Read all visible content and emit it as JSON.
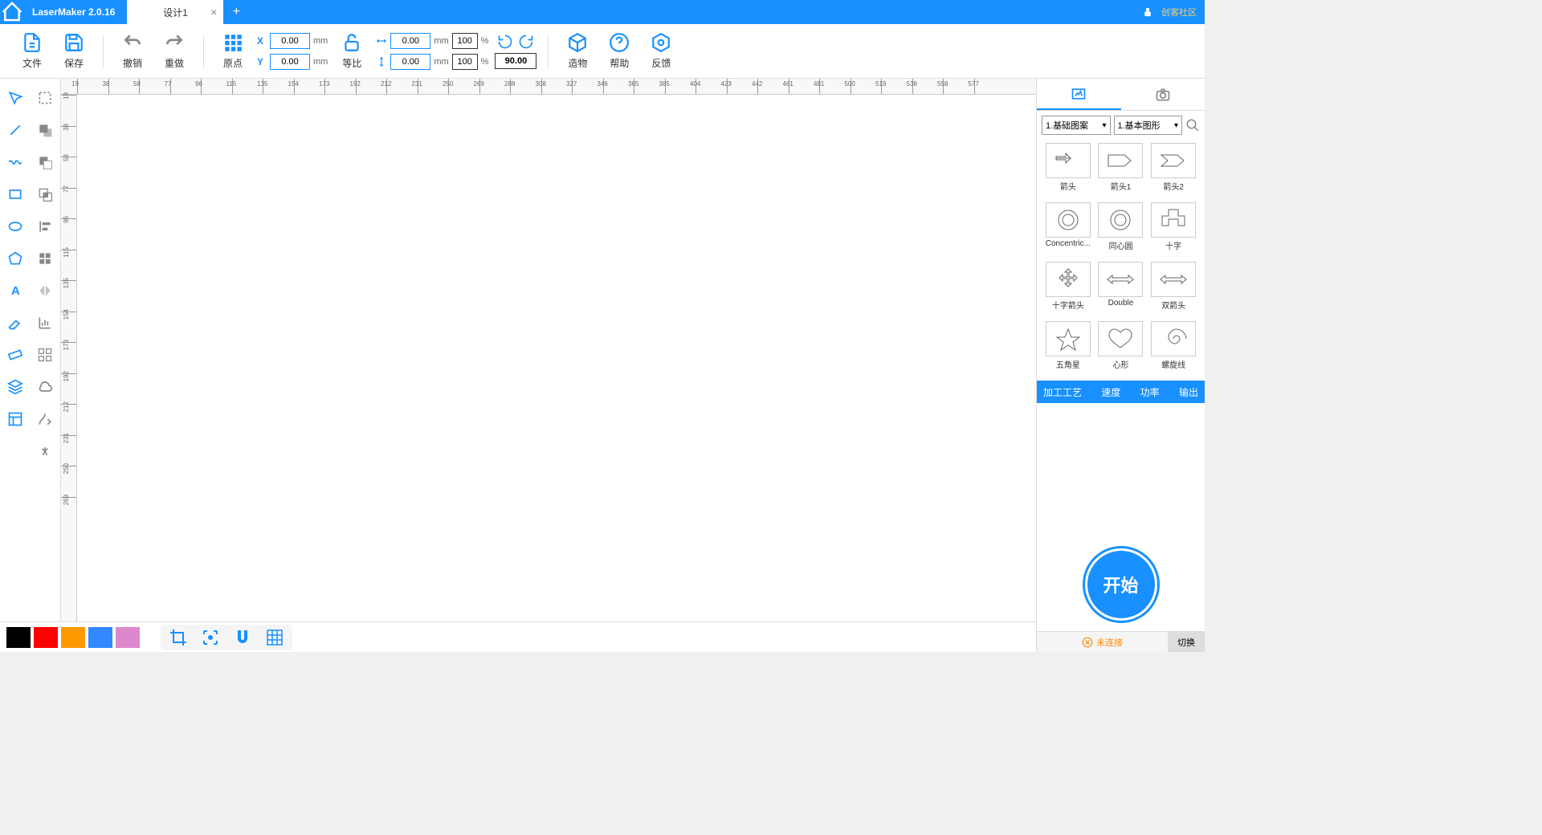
{
  "app": {
    "name": "LaserMaker 2.0.16",
    "community": "创客社区"
  },
  "tabs": [
    {
      "label": "设计1"
    }
  ],
  "toolbar": {
    "file": "文件",
    "save": "保存",
    "undo": "撤销",
    "redo": "重做",
    "origin": "原点",
    "ratio": "等比",
    "create": "造物",
    "help": "帮助",
    "feedback": "反馈"
  },
  "coords": {
    "x": "0.00",
    "y": "0.00",
    "w": "0.00",
    "h": "0.00",
    "wp": "100",
    "hp": "100",
    "angle": "90.00",
    "mm": "mm",
    "pct": "%"
  },
  "ruler": {
    "unit": "mm",
    "h": [
      "19",
      "38",
      "58",
      "77",
      "96",
      "115",
      "135",
      "154",
      "173",
      "192",
      "212",
      "231",
      "250",
      "269",
      "288",
      "308",
      "327",
      "346",
      "365",
      "385",
      "404",
      "423",
      "442",
      "461",
      "481",
      "500",
      "519",
      "538",
      "558",
      "577"
    ],
    "v": [
      "19",
      "38",
      "58",
      "77",
      "96",
      "115",
      "135",
      "154",
      "173",
      "192",
      "212",
      "231",
      "250",
      "269"
    ]
  },
  "panel": {
    "cat1": "1.基础图案",
    "cat2": "1.基本图形",
    "shapes": [
      {
        "name": "箭头"
      },
      {
        "name": "箭头1"
      },
      {
        "name": "箭头2"
      },
      {
        "name": "Concentric..."
      },
      {
        "name": "同心圆"
      },
      {
        "name": "十字"
      },
      {
        "name": "十字箭头"
      },
      {
        "name": "Double"
      },
      {
        "name": "双箭头"
      },
      {
        "name": "五角星"
      },
      {
        "name": "心形"
      },
      {
        "name": "螺旋线"
      }
    ]
  },
  "process": {
    "craft": "加工工艺",
    "speed": "速度",
    "power": "功率",
    "output": "输出"
  },
  "start": "开始",
  "status": {
    "disconnected": "未连接",
    "switch": "切换"
  },
  "colors": [
    "#000000",
    "#ff0000",
    "#ff9900",
    "#3388ff",
    "#dd88cc"
  ]
}
